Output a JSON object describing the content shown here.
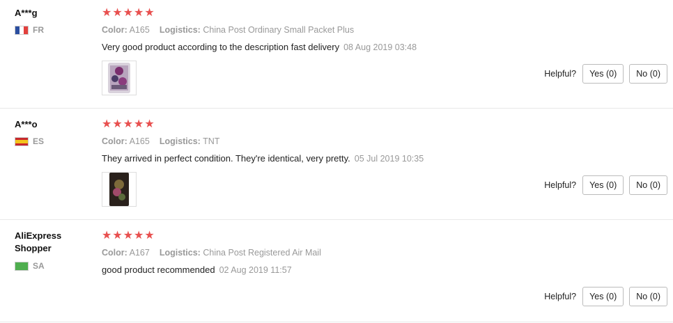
{
  "labels": {
    "color": "Color:",
    "logistics": "Logistics:",
    "helpful": "Helpful?"
  },
  "colors": {
    "stars": "#e8504f",
    "muted": "#999999"
  },
  "reviews": [
    {
      "user": "A***g",
      "country": "FR",
      "flag": "france-flag",
      "rating": 5,
      "stars": "★★★★★",
      "color": "A165",
      "logistics": "China Post Ordinary Small Packet Plus",
      "text": "Very good product according to the description fast delivery",
      "date": "08 Aug 2019 03:48",
      "has_image": true,
      "yes": "Yes (0)",
      "no": "No (0)"
    },
    {
      "user": "A***o",
      "country": "ES",
      "flag": "spain-flag",
      "rating": 5,
      "stars": "★★★★★",
      "color": "A165",
      "logistics": "TNT",
      "text": "They arrived in perfect condition. They're identical, very pretty.",
      "date": "05 Jul 2019 10:35",
      "has_image": true,
      "yes": "Yes (0)",
      "no": "No (0)"
    },
    {
      "user": "AliExpress Shopper",
      "country": "SA",
      "flag": "saudi-arabia-flag",
      "rating": 5,
      "stars": "★★★★★",
      "color": "A167",
      "logistics": "China Post Registered Air Mail",
      "text": "good product recommended",
      "date": "02 Aug 2019 11:57",
      "has_image": false,
      "yes": "Yes (0)",
      "no": "No (0)"
    }
  ]
}
